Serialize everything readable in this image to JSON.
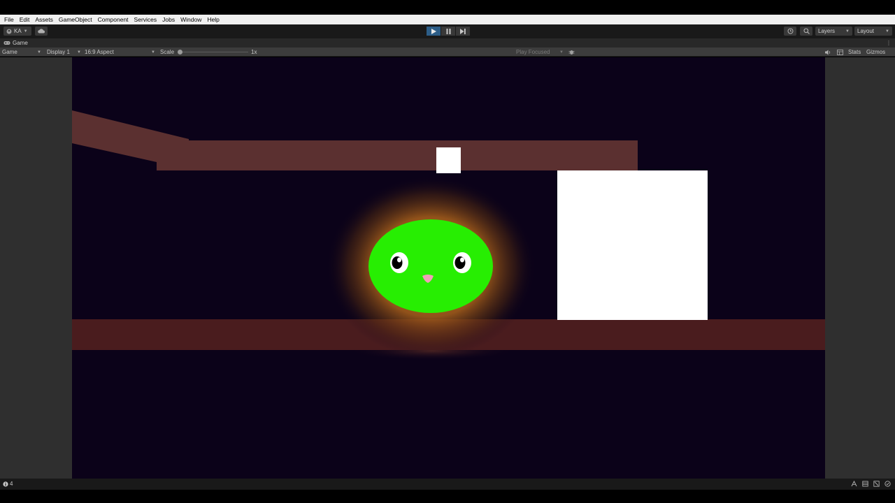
{
  "menu": [
    "File",
    "Edit",
    "Assets",
    "GameObject",
    "Component",
    "Services",
    "Jobs",
    "Window",
    "Help"
  ],
  "toolbar": {
    "account_label": "KA",
    "layers_label": "Layers",
    "layout_label": "Layout"
  },
  "tab": {
    "label": "Game"
  },
  "game_toolbar": {
    "mode": "Game",
    "display": "Display 1",
    "aspect": "16:9 Aspect",
    "scale_label": "Scale",
    "scale_value": "1x",
    "play_focused": "Play Focused",
    "stats": "Stats",
    "gizmos": "Gizmos"
  },
  "status": {
    "count": "4"
  },
  "icons": {
    "account": "account-icon",
    "cloud": "cloud-icon",
    "play": "play-icon",
    "pause": "pause-icon",
    "step": "step-icon",
    "history": "history-icon",
    "search": "search-icon",
    "game_tab": "gamepad-icon",
    "bug": "bug-icon",
    "audio": "speaker-icon",
    "stats": "stats-icon"
  },
  "colors": {
    "game_background": "#0b0219",
    "platform": "#5b3030",
    "floor": "#4a1c1e",
    "slime": "#27ee02",
    "glow": "#c8781e",
    "block": "#ffffff",
    "nose": "#f0a0b8",
    "play_active": "#2c5d87"
  }
}
